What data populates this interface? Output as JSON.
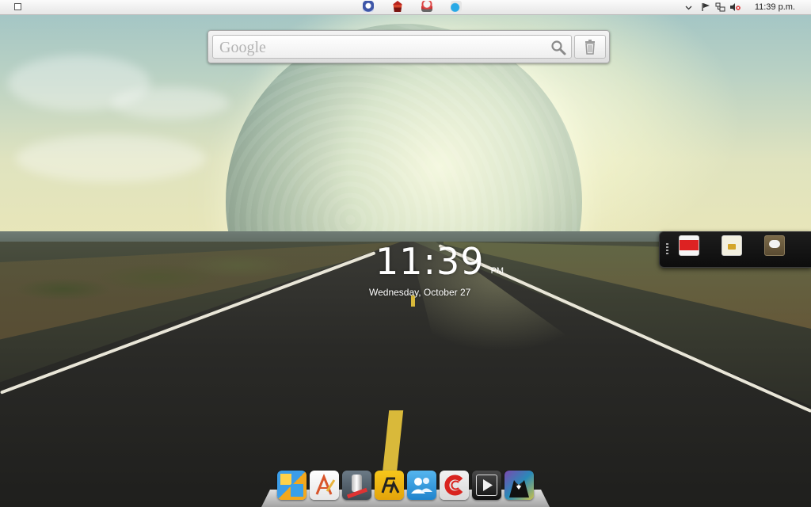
{
  "top_panel": {
    "launchers": [
      "mozilla-launcher-icon",
      "temple-launcher-icon",
      "robot-launcher-icon",
      "skype-launcher-icon"
    ],
    "tray": [
      "chevron-down-icon",
      "flag-icon",
      "network-icon",
      "volume-muted-icon"
    ],
    "clock": "11:39 p.m."
  },
  "search_widget": {
    "placeholder": "Google",
    "search_icon": "magnifier-icon",
    "trash_icon": "trash-icon"
  },
  "clock_widget": {
    "time": "11:39",
    "ampm": "PM",
    "date": "Wednesday, October 27"
  },
  "side_panel": {
    "items": [
      "video-icon",
      "sim-card-icon",
      "chat-bubble-icon"
    ]
  },
  "dock": {
    "items": [
      "files-icon",
      "text-editor-icon",
      "system-tools-icon",
      "flash-icon",
      "users-icon",
      "camera-capture-icon",
      "media-player-icon",
      "tuxedo-icon"
    ]
  },
  "colors": {
    "panel_bg": "#efefef",
    "road_line": "#d9b93a",
    "clock_text": "#ffffff"
  }
}
